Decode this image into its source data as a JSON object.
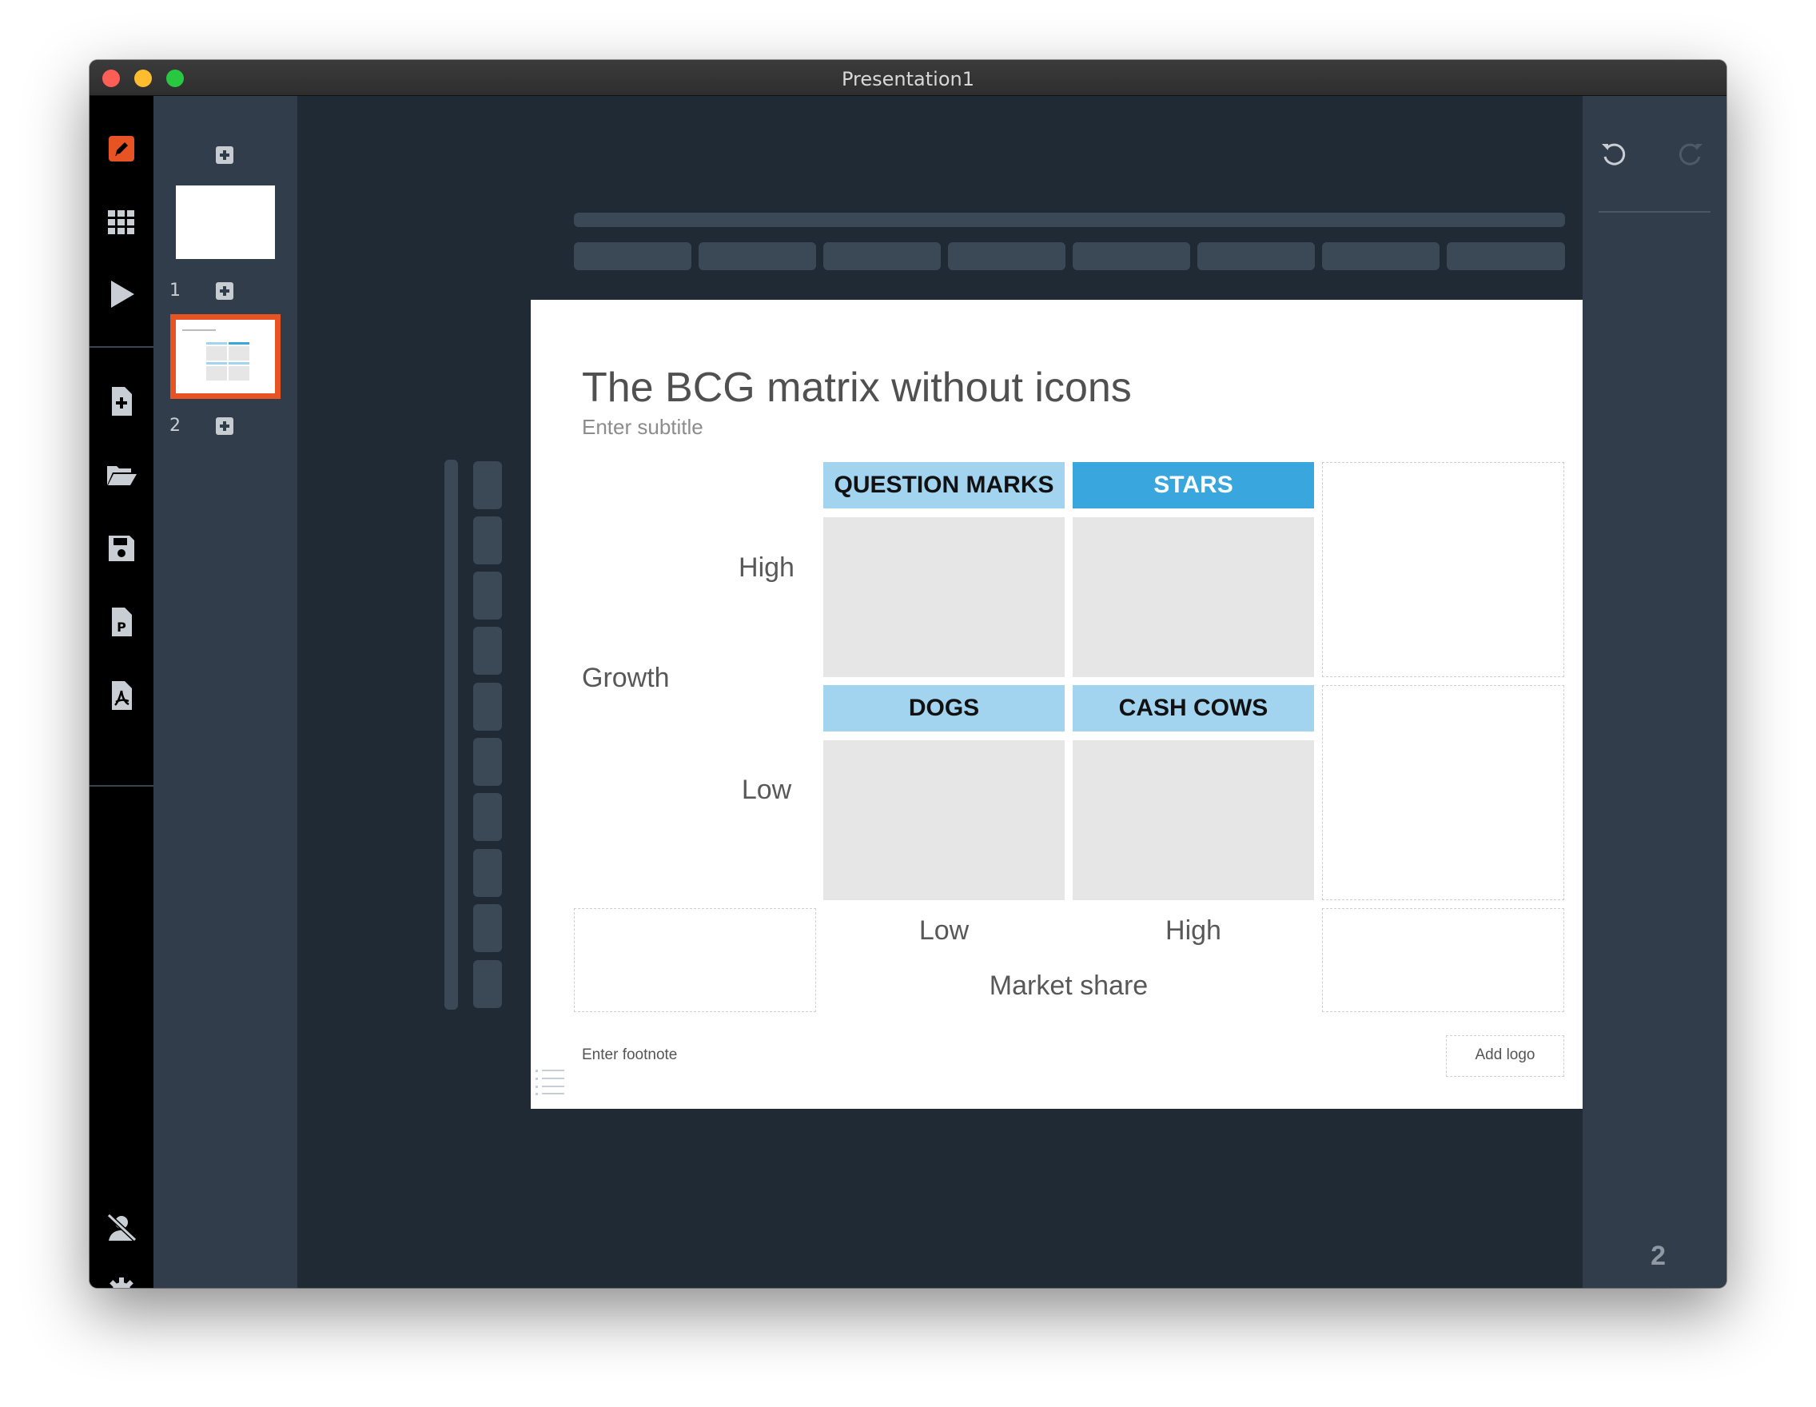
{
  "window": {
    "title": "Presentation1"
  },
  "left_toolbar": {
    "icons": [
      "edit-icon",
      "grid-icon",
      "play-icon",
      "new-file-icon",
      "open-folder-icon",
      "save-icon",
      "powerpoint-export-icon",
      "pdf-export-icon",
      "account-icon",
      "settings-icon"
    ],
    "accent_color": "#e85324"
  },
  "slide_panel": {
    "slides": [
      {
        "number": "1"
      },
      {
        "number": "2"
      }
    ]
  },
  "slide": {
    "title": "The BCG matrix without icons",
    "subtitle": "Enter subtitle",
    "quadrants": {
      "question_marks": "QUESTION MARKS",
      "stars": "STARS",
      "dogs": "DOGS",
      "cash_cows": "CASH COWS"
    },
    "y_axis": {
      "label": "Growth",
      "high": "High",
      "low": "Low"
    },
    "x_axis": {
      "label": "Market share",
      "low": "Low",
      "high": "High"
    },
    "footnote": "Enter footnote",
    "logo": "Add logo",
    "colors": {
      "light_header": "#a2d3ef",
      "stars_header": "#3aa6de",
      "quadrant_body": "#e6e6e6"
    }
  },
  "right_panel": {
    "page_number": "2"
  }
}
